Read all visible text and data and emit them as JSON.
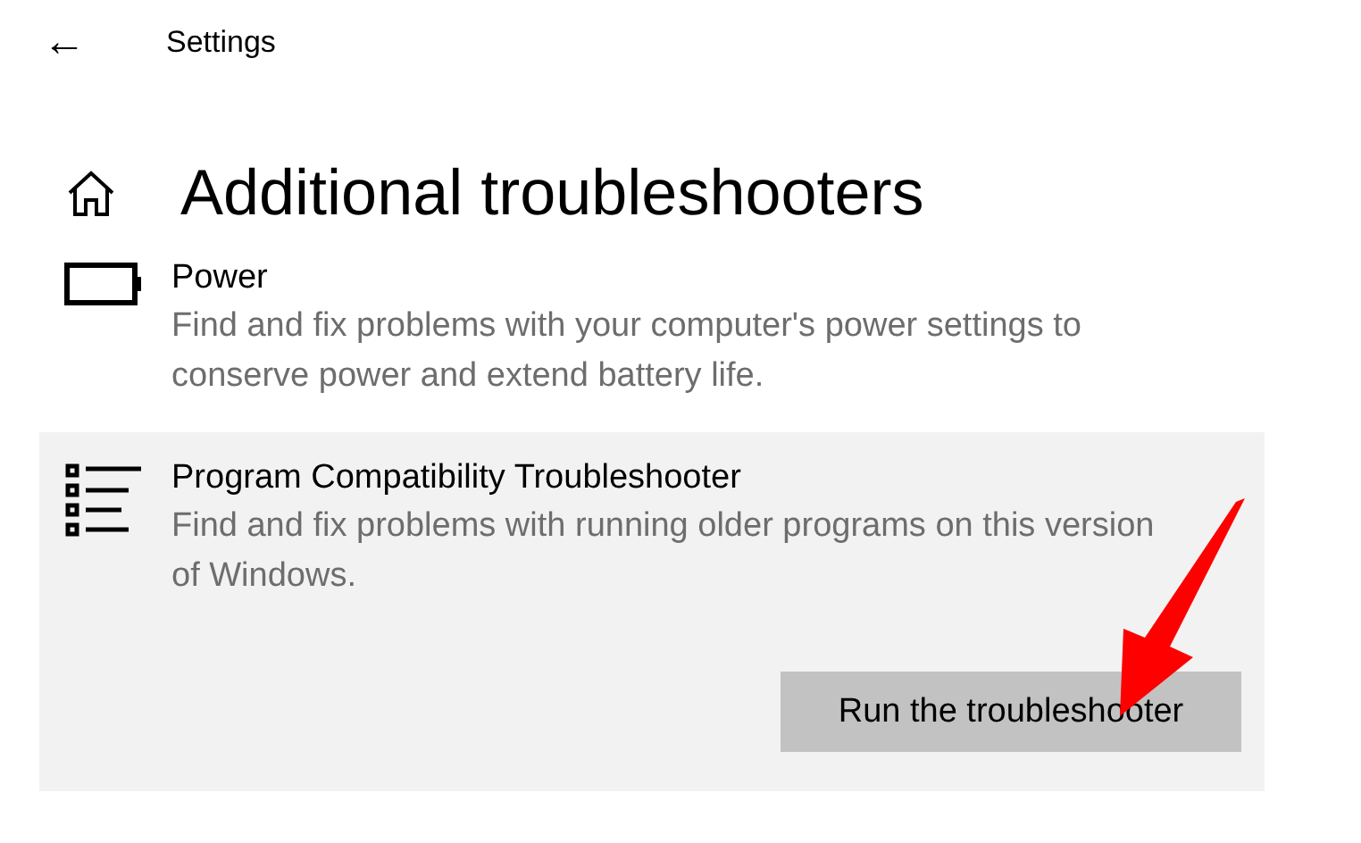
{
  "header": {
    "back": "←",
    "title": "Settings"
  },
  "page": {
    "title": "Additional troubleshooters"
  },
  "items": [
    {
      "kind": "power",
      "title": "Power",
      "description": "Find and fix problems with your computer's power settings to conserve power and extend battery life.",
      "expanded": false
    },
    {
      "kind": "list",
      "title": "Program Compatibility Troubleshooter",
      "description": "Find and fix problems with running older programs on this version of Windows.",
      "expanded": true,
      "button": "Run the troubleshooter"
    }
  ],
  "annotation": {
    "kind": "arrow"
  }
}
